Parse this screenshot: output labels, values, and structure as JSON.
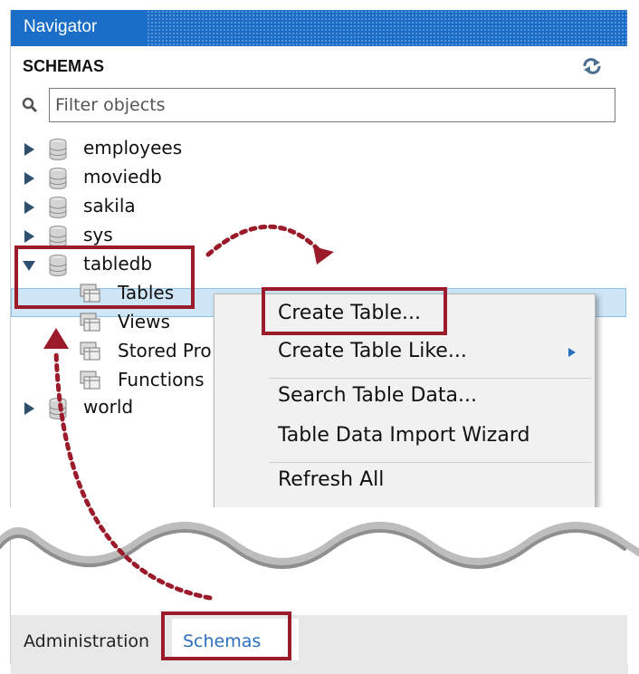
{
  "navigator": {
    "title": "Navigator",
    "section_title": "SCHEMAS",
    "filter_placeholder": "Filter objects"
  },
  "schemas": [
    {
      "name": "employees",
      "expanded": false
    },
    {
      "name": "moviedb",
      "expanded": false
    },
    {
      "name": "sakila",
      "expanded": false
    },
    {
      "name": "sys",
      "expanded": false
    },
    {
      "name": "tabledb",
      "expanded": true
    },
    {
      "name": "world",
      "expanded": false
    }
  ],
  "tabledb_children": [
    {
      "label": "Tables",
      "selected": true
    },
    {
      "label": "Views"
    },
    {
      "label": "Stored Pro"
    },
    {
      "label": "Functions"
    }
  ],
  "context_menu": {
    "items": [
      "Create Table...",
      "Create Table Like...",
      "Search Table Data...",
      "Table Data Import Wizard",
      "Refresh All"
    ]
  },
  "bottom_tabs": {
    "administration": "Administration",
    "schemas": "Schemas"
  },
  "colors": {
    "header_blue": "#1a6ec7",
    "selection": "#cfe6f7",
    "annotation_red": "#9b1b2a",
    "tab_link_blue": "#2b6fc0"
  }
}
